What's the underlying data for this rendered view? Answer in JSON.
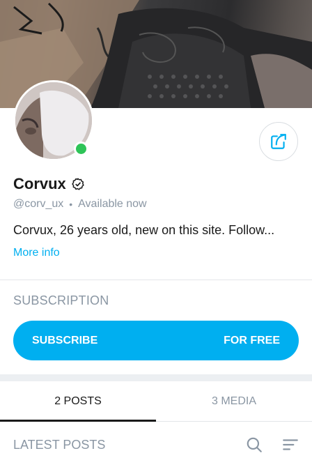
{
  "profile": {
    "name": "Corvux",
    "handle": "@corv_ux",
    "separator": "•",
    "status": "Available now",
    "bio": "Corvux, 26 years old, new on this site. Follow...",
    "more_info_label": "More info",
    "online": true
  },
  "subscription": {
    "title": "SUBSCRIPTION",
    "button_label": "SUBSCRIBE",
    "price_label": "FOR FREE"
  },
  "tabs": [
    {
      "label": "2 POSTS",
      "active": true
    },
    {
      "label": "3 MEDIA",
      "active": false
    }
  ],
  "posts": {
    "title": "LATEST POSTS",
    "search_icon": "search-icon",
    "filter_icon": "sort-filter-icon"
  },
  "colors": {
    "accent": "#00aff0",
    "online": "#2ec458",
    "muted_text": "#8a96a3",
    "primary_text": "#1a1a1a"
  }
}
